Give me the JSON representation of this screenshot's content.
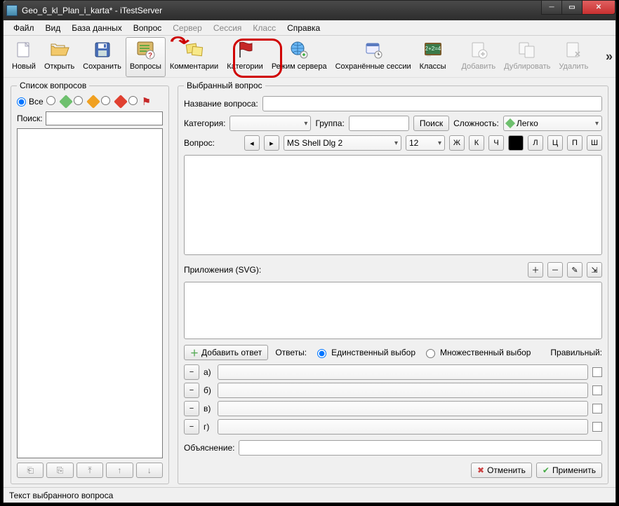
{
  "title": "Geo_6_kl_Plan_i_karta* - iTestServer",
  "menu": {
    "file": "Файл",
    "view": "Вид",
    "db": "База данных",
    "question": "Вопрос",
    "server": "Сервер",
    "session": "Сессия",
    "class": "Класс",
    "help": "Справка"
  },
  "tool": {
    "new": "Новый",
    "open": "Открыть",
    "save": "Сохранить",
    "questions": "Вопросы",
    "comments": "Комментарии",
    "categories": "Категории",
    "server": "Режим сервера",
    "sessions": "Сохранённые сессии",
    "classes": "Классы",
    "add": "Добавить",
    "duplicate": "Дублировать",
    "delete": "Удалить"
  },
  "left": {
    "group": "Список вопросов",
    "all": "Все",
    "search": "Поиск:"
  },
  "right": {
    "group": "Выбранный вопрос",
    "name": "Название вопроса:",
    "category": "Категория:",
    "group_lbl": "Группа:",
    "search": "Поиск",
    "difficulty": "Сложность:",
    "difficulty_val": "Легко",
    "question": "Вопрос:",
    "font": "MS Shell Dlg 2",
    "fontsize": "12",
    "fmt": {
      "b": "Ж",
      "i": "К",
      "u": "Ч",
      "l": "Л",
      "c": "Ц",
      "r": "П",
      "j": "Ш"
    },
    "attachments": "Приложения (SVG):",
    "add_answer": "Добавить ответ",
    "answers": "Ответы:",
    "single": "Единственный выбор",
    "multiple": "Множественный выбор",
    "correct": "Правильный:",
    "a": "а)",
    "b": "б)",
    "c": "в)",
    "d": "г)",
    "explanation": "Объяснение:",
    "cancel": "Отменить",
    "apply": "Применить"
  },
  "status": "Текст выбранного вопроса"
}
